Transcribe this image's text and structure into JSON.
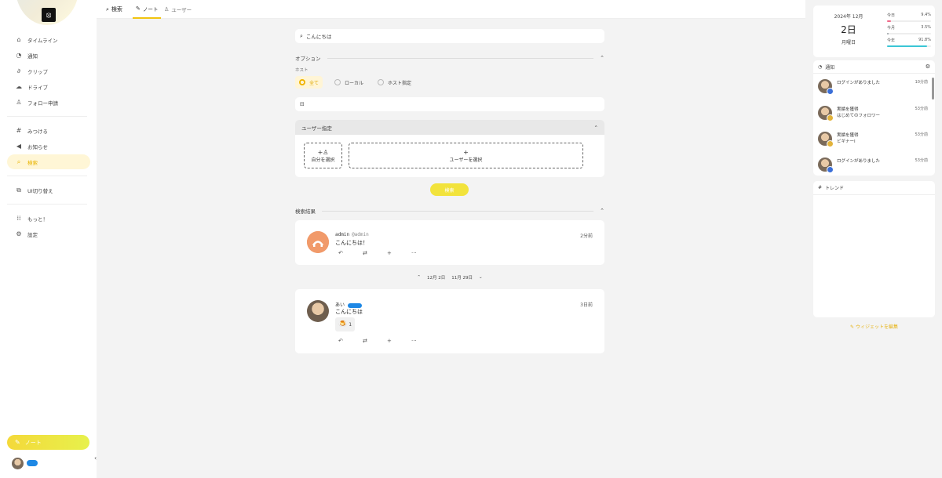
{
  "sidebar": {
    "nav": [
      {
        "icon": "home-icon",
        "glyph": "⌂",
        "label": "タイムライン"
      },
      {
        "icon": "bell-icon",
        "glyph": "♫",
        "label": "通知"
      },
      {
        "icon": "paperclip-icon",
        "glyph": "∂",
        "label": "クリップ"
      },
      {
        "icon": "cloud-icon",
        "glyph": "☁",
        "label": "ドライブ"
      },
      {
        "icon": "user-plus-icon",
        "glyph": "♙",
        "label": "フォロー申請"
      },
      {
        "icon": "hash-icon",
        "glyph": "#",
        "label": "みつける"
      },
      {
        "icon": "megaphone-icon",
        "glyph": "✎",
        "label": "お知らせ"
      },
      {
        "icon": "search-icon",
        "glyph": "⌕",
        "label": "検索"
      },
      {
        "icon": "switch-icon",
        "glyph": "⧉",
        "label": "UI切り替え"
      },
      {
        "icon": "grid-icon",
        "glyph": "⋮⋮",
        "label": "もっと！"
      },
      {
        "icon": "gear-icon",
        "glyph": "⚙",
        "label": "設定"
      }
    ],
    "note_button": "ノート",
    "active_color": "#e9b400"
  },
  "header": {
    "title": "検索",
    "tabs": [
      "ノート",
      "ユーザー"
    ]
  },
  "search": {
    "query": "こんにちは",
    "options_label": "オプション",
    "host_label": "ホスト",
    "host_options": [
      "全て",
      "ローカル",
      "ホスト指定"
    ],
    "host_selected": "全て",
    "user_section_label": "ユーザー指定",
    "pick_self": "自分を選択",
    "pick_user": "ユーザーを選択",
    "search_button": "検索",
    "results_label": "検索結果"
  },
  "results": [
    {
      "display_name": "admin",
      "acct": "@admin",
      "time": "2分前",
      "text": "こんにちは！"
    },
    {
      "display_name": "あい",
      "time": "3日前",
      "text": "こんにちは",
      "reaction_emoji": "🍮",
      "reaction_count": "1"
    }
  ],
  "date_separator": {
    "prev": "12月 2日",
    "next": "11月 29日"
  },
  "calendar": {
    "year_month": "2024年 12月",
    "day": "2日",
    "weekday": "月曜日",
    "progress": [
      {
        "label": "今日",
        "value": "9.4%",
        "fraction": 0.094,
        "color": "#f06a8a"
      },
      {
        "label": "今月",
        "value": "3.5%",
        "fraction": 0.035,
        "color": "#9aa0a6"
      },
      {
        "label": "今年",
        "value": "91.8%",
        "fraction": 0.918,
        "color": "#3bc6d6"
      }
    ]
  },
  "notifications": {
    "title": "通知",
    "items": [
      {
        "title": "ログインがありました",
        "sub": "",
        "time": "10分前",
        "badge_color": "#3b6fd8"
      },
      {
        "title": "実績を獲得",
        "sub": "はじめてのフォロワー",
        "time": "53分前",
        "badge_color": "#e2b33b"
      },
      {
        "title": "実績を獲得",
        "sub": "ビギナーⅠ",
        "time": "53分前",
        "badge_color": "#e2b33b"
      },
      {
        "title": "ログインがありました",
        "sub": "",
        "time": "53分前",
        "badge_color": "#3b6fd8"
      }
    ]
  },
  "trend": {
    "title": "トレンド"
  },
  "edit_widgets": "ウィジェットを編集"
}
